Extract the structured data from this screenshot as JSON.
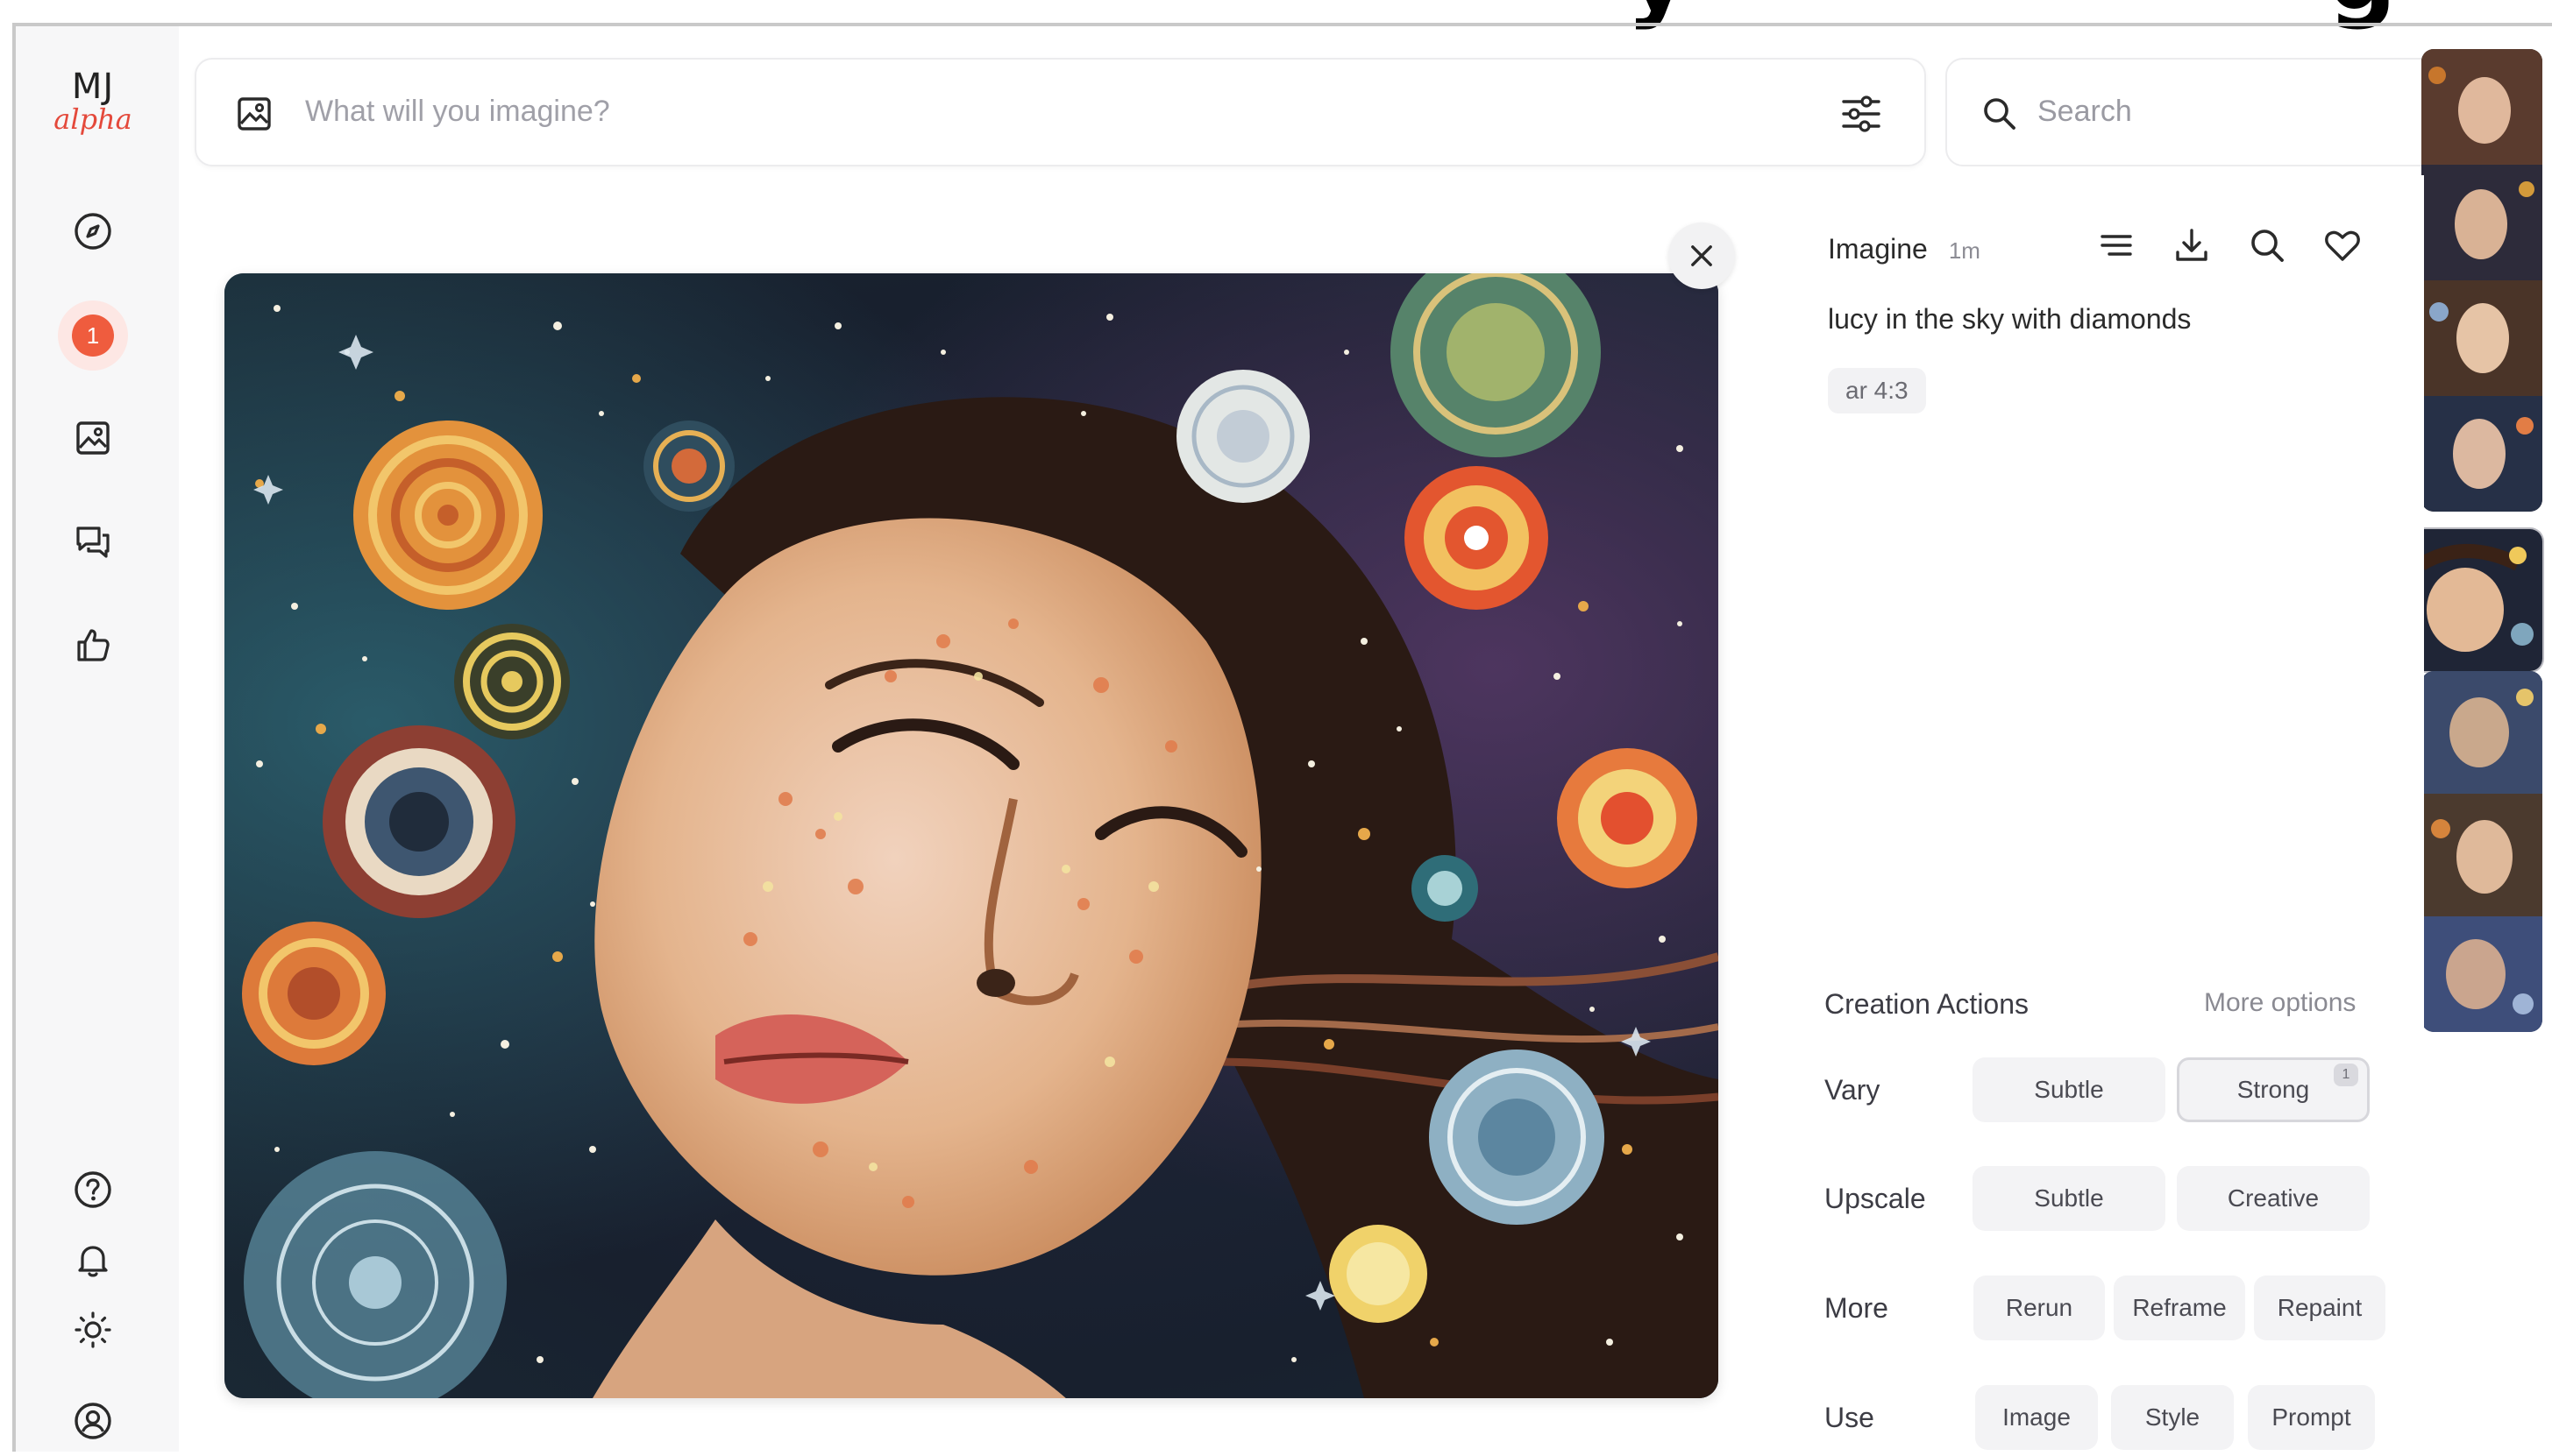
{
  "app": {
    "logo_top": "MJ",
    "logo_bottom": "alpha",
    "notification_count": "1"
  },
  "sidebar": {
    "items": [
      {
        "icon": "compass-icon"
      },
      {
        "icon": "notification-badge"
      },
      {
        "icon": "image-icon"
      },
      {
        "icon": "chat-icon"
      },
      {
        "icon": "thumbs-up-icon"
      }
    ],
    "bottom": [
      {
        "icon": "help-icon"
      },
      {
        "icon": "bell-icon"
      },
      {
        "icon": "sun-icon"
      },
      {
        "icon": "profile-icon"
      }
    ]
  },
  "prompt_bar": {
    "placeholder": "What will you imagine?"
  },
  "search": {
    "placeholder": "Search"
  },
  "detail": {
    "action": "Imagine",
    "age": "1m",
    "prompt": "lucy in the sky with diamonds",
    "param_chip": "ar 4:3"
  },
  "creation_actions": {
    "title": "Creation Actions",
    "more_options": "More options",
    "vary": {
      "label": "Vary",
      "subtle": "Subtle",
      "strong": "Strong",
      "strong_count": "1"
    },
    "upscale": {
      "label": "Upscale",
      "subtle": "Subtle",
      "creative": "Creative"
    },
    "more": {
      "label": "More",
      "rerun": "Rerun",
      "reframe": "Reframe",
      "repaint": "Repaint"
    },
    "use": {
      "label": "Use",
      "image": "Image",
      "style": "Style",
      "prompt": "Prompt"
    }
  },
  "colors": {
    "accent": "#ef5c3e",
    "logo_alpha": "#e4493b"
  }
}
